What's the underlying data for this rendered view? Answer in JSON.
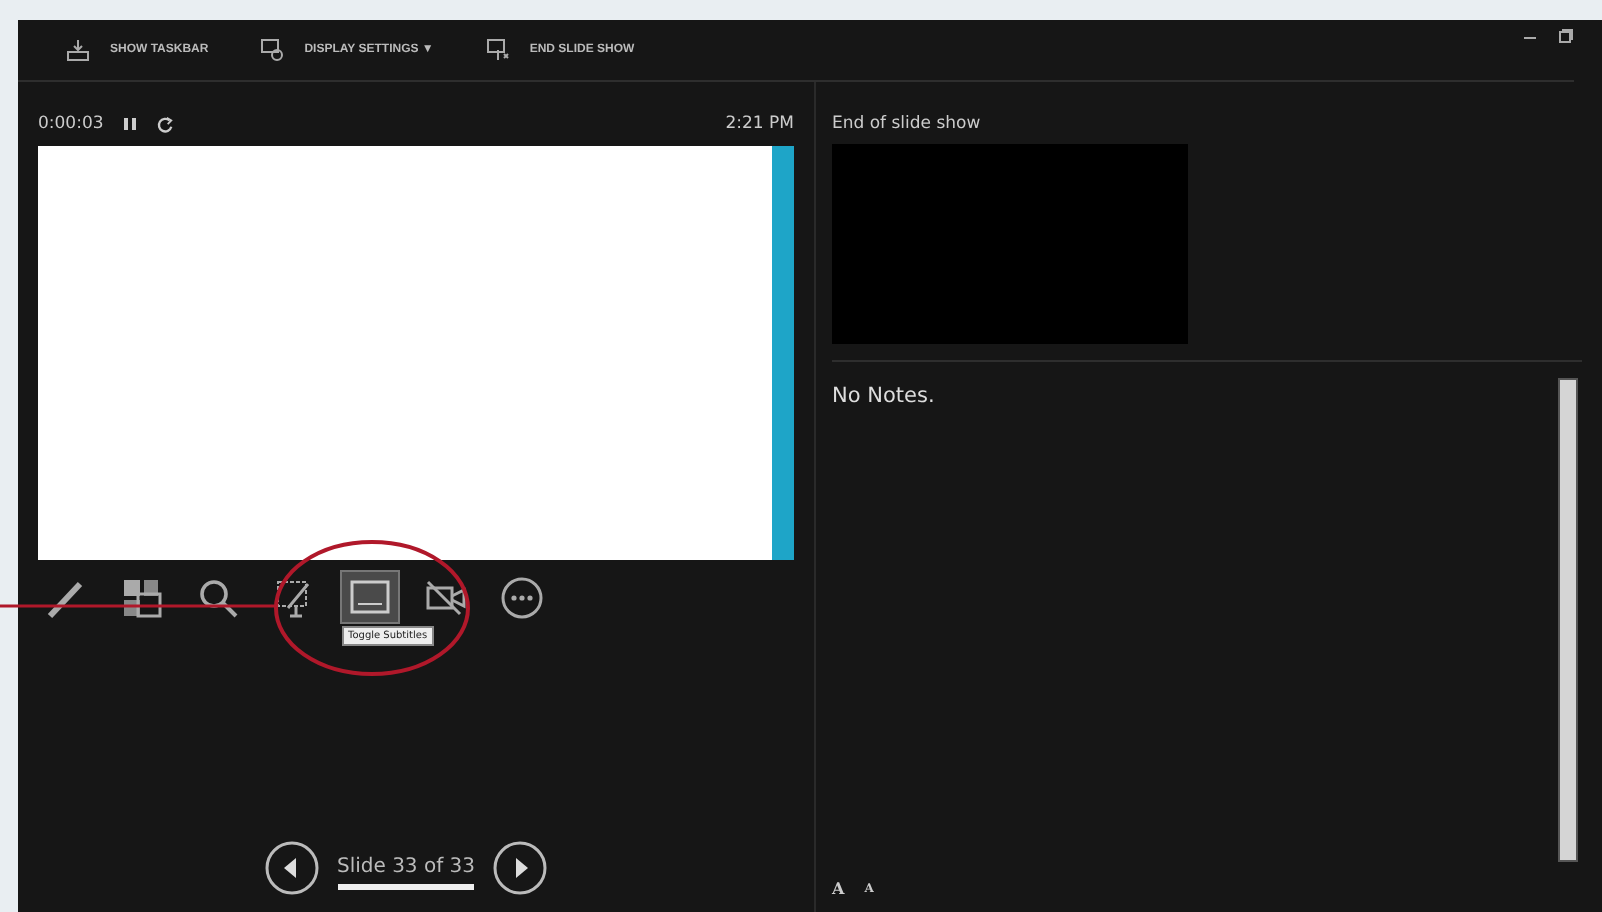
{
  "toolbar": [
    {
      "kind": "taskbar",
      "label": "SHOW TASKBAR"
    },
    {
      "kind": "display",
      "label": "DISPLAY SETTINGS ▼"
    },
    {
      "kind": "end",
      "label": "END SLIDE SHOW"
    }
  ],
  "timer": {
    "elapsed": "0:00:03",
    "clock": "2:21 PM"
  },
  "tools": [
    {
      "kind": "pen",
      "selected": false
    },
    {
      "kind": "grid",
      "selected": false
    },
    {
      "kind": "zoom",
      "selected": false
    },
    {
      "kind": "pointer",
      "selected": false
    },
    {
      "kind": "subtitles",
      "selected": true
    },
    {
      "kind": "camera",
      "selected": false
    },
    {
      "kind": "more",
      "selected": false
    }
  ],
  "tooltip": "Toggle Subtitles",
  "navigation": {
    "label": "Slide 33 of 33"
  },
  "next_slide": {
    "label": "End of slide show"
  },
  "notes": {
    "text": "No Notes."
  },
  "font_buttons": [
    {
      "label": "A",
      "kind": "grow"
    },
    {
      "label": "A",
      "kind": "shrink"
    }
  ]
}
